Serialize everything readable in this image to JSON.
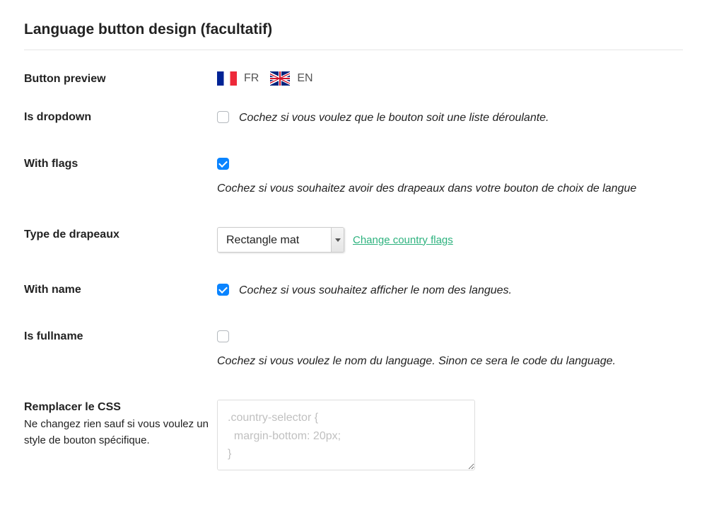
{
  "section_title": "Language button design (facultatif)",
  "preview": {
    "label": "Button preview",
    "langs": [
      {
        "code": "FR",
        "flag": "fr"
      },
      {
        "code": "EN",
        "flag": "uk"
      }
    ]
  },
  "is_dropdown": {
    "label": "Is dropdown",
    "checked": false,
    "description": "Cochez si vous voulez que le bouton soit une liste déroulante."
  },
  "with_flags": {
    "label": "With flags",
    "checked": true,
    "description": "Cochez si vous souhaitez avoir des drapeaux dans votre bouton de choix de langue"
  },
  "flag_type": {
    "label": "Type de drapeaux",
    "value": "Rectangle mat",
    "change_link": "Change country flags"
  },
  "with_name": {
    "label": "With name",
    "checked": true,
    "description": "Cochez si vous souhaitez afficher le nom des langues."
  },
  "is_fullname": {
    "label": "Is fullname",
    "checked": false,
    "description": "Cochez si vous voulez le nom du language. Sinon ce sera le code du language."
  },
  "css": {
    "label": "Remplacer le CSS",
    "sublabel": "Ne changez rien sauf si vous voulez un style de bouton spécifique.",
    "placeholder": ".country-selector {\n  margin-bottom: 20px;\n}"
  }
}
